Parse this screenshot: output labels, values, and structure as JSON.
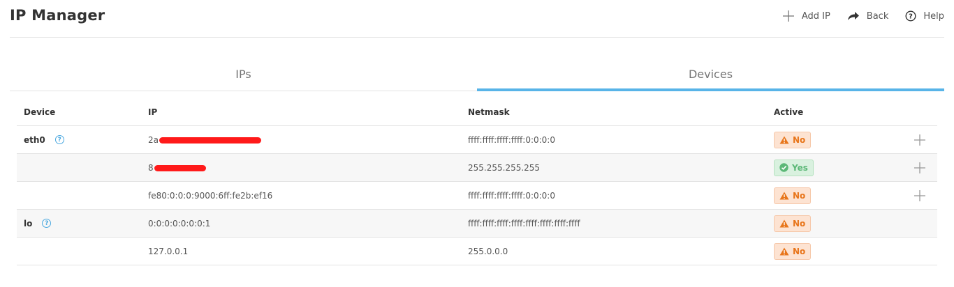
{
  "header": {
    "title": "IP Manager",
    "actions": [
      {
        "label": "Add IP",
        "icon": "plus-icon"
      },
      {
        "label": "Back",
        "icon": "share-arrow-icon"
      },
      {
        "label": "Help",
        "icon": "question-circle-icon"
      }
    ]
  },
  "tabs": [
    {
      "label": "IPs",
      "active": false
    },
    {
      "label": "Devices",
      "active": true
    }
  ],
  "table": {
    "columns": [
      "Device",
      "IP",
      "Netmask",
      "Active"
    ],
    "rows": [
      {
        "device": "eth0",
        "ip": "2a",
        "netmask": "ffff:ffff:ffff:ffff:0:0:0:0",
        "active": "No"
      },
      {
        "device": "",
        "ip": "8",
        "netmask": "255.255.255.255",
        "active": "Yes"
      },
      {
        "device": "",
        "ip": "fe80:0:0:0:9000:6ff:fe2b:ef16",
        "netmask": "ffff:ffff:ffff:ffff:0:0:0:0",
        "active": "No"
      },
      {
        "device": "lo",
        "ip": "0:0:0:0:0:0:0:1",
        "netmask": "ffff:ffff:ffff:ffff:ffff:ffff:ffff:ffff",
        "active": "No"
      },
      {
        "device": "",
        "ip": "127.0.0.1",
        "netmask": "255.0.0.0",
        "active": "No"
      }
    ]
  },
  "colors": {
    "accent": "#58b4e8",
    "no_badge": "#e8751a",
    "yes_badge": "#5cb877"
  }
}
